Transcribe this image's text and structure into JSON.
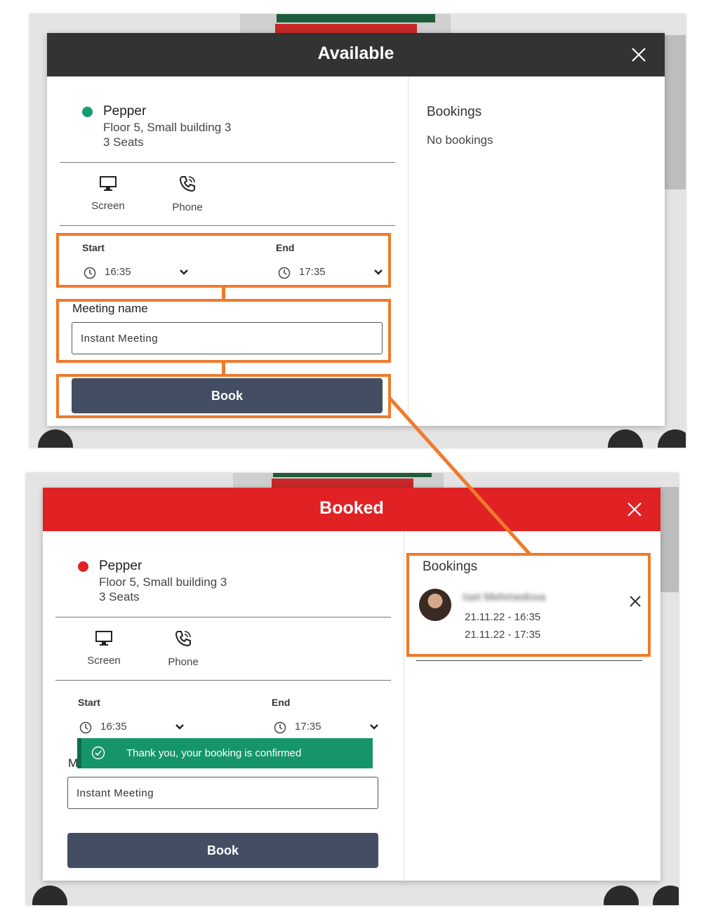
{
  "colors": {
    "available_header": "#333333",
    "booked_header": "#e02225",
    "available_dot": "#149c73",
    "booked_dot": "#e02225",
    "book_button": "#434e62",
    "toast": "#16946a",
    "highlight": "#f07a2b"
  },
  "top_modal": {
    "status_title": "Available",
    "room": {
      "name": "Pepper",
      "location": "Floor 5, Small building 3",
      "seats": "3 Seats"
    },
    "features": [
      {
        "icon": "monitor-icon",
        "label": "Screen"
      },
      {
        "icon": "phone-icon",
        "label": "Phone"
      }
    ],
    "start_label": "Start",
    "start_time": "16:35",
    "end_label": "End",
    "end_time": "17:35",
    "meeting_name_label": "Meeting name",
    "meeting_name_value": "Instant Meeting",
    "book_label": "Book",
    "bookings_title": "Bookings",
    "no_bookings": "No bookings"
  },
  "bottom_modal": {
    "status_title": "Booked",
    "room": {
      "name": "Pepper",
      "location": "Floor 5, Small building 3",
      "seats": "3 Seats"
    },
    "features": [
      {
        "icon": "monitor-icon",
        "label": "Screen"
      },
      {
        "icon": "phone-icon",
        "label": "Phone"
      }
    ],
    "start_label": "Start",
    "start_time": "16:35",
    "end_label": "End",
    "end_time": "17:35",
    "meeting_name_label_partial": "M",
    "meeting_name_value": "Instant Meeting",
    "book_label": "Book",
    "toast": "Thank you, your booking is confirmed",
    "bookings_title": "Bookings",
    "booking": {
      "name": "Iset Mehmedova",
      "start": "21.11.22 - 16:35",
      "end": "21.11.22 - 17:35"
    }
  }
}
